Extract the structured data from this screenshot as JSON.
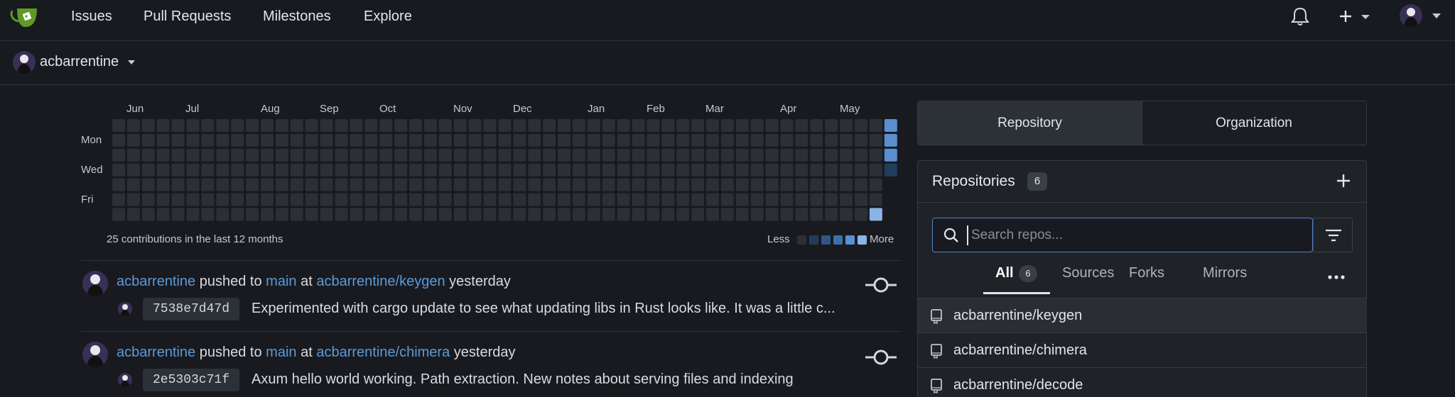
{
  "nav": {
    "links": [
      "Issues",
      "Pull Requests",
      "Milestones",
      "Explore"
    ]
  },
  "context": {
    "user": "acbarrentine"
  },
  "heatmap": {
    "months": [
      "Jun",
      "Jul",
      "Aug",
      "Sep",
      "Oct",
      "Nov",
      "Dec",
      "Jan",
      "Feb",
      "Mar",
      "Apr",
      "May"
    ],
    "days": [
      "Mon",
      "Wed",
      "Fri"
    ],
    "weeks": 53,
    "total": "25 contributions in the last 12 months",
    "legend_less": "Less",
    "legend_more": "More",
    "colors": [
      "#2b2f36",
      "#223c5e",
      "#2e5688",
      "#3d6fae",
      "#5a8fd0",
      "#8ab3e6"
    ],
    "active_cells": [
      [
        51,
        6,
        4
      ],
      [
        52,
        0,
        3
      ],
      [
        52,
        1,
        3
      ],
      [
        52,
        2,
        3
      ],
      [
        52,
        3,
        0
      ]
    ]
  },
  "feed": [
    {
      "user": "acbarrentine",
      "verb": "pushed to",
      "branch": "main",
      "at": "at",
      "repo": "acbarrentine/keygen",
      "when": "yesterday",
      "sha": "7538e7d47d",
      "message": "Experimented with cargo update to see what updating libs in Rust looks like. It was a little c..."
    },
    {
      "user": "acbarrentine",
      "verb": "pushed to",
      "branch": "main",
      "at": "at",
      "repo": "acbarrentine/chimera",
      "when": "yesterday",
      "sha": "2e5303c71f",
      "message": "Axum hello world working. Path extraction. New notes about serving files and indexing"
    }
  ],
  "side": {
    "tabs": [
      "Repository",
      "Organization"
    ],
    "title": "Repositories",
    "count": "6",
    "search_placeholder": "Search repos...",
    "filter_tabs": [
      "All",
      "Sources",
      "Forks",
      "Mirrors"
    ],
    "all_count": "6",
    "repos": [
      "acbarrentine/keygen",
      "acbarrentine/chimera",
      "acbarrentine/decode"
    ]
  },
  "icons": {
    "logo": "gitea-teacup-logo",
    "bell": "bell-icon",
    "plus": "plus-icon",
    "commit": "git-commit-icon",
    "repo": "repo-book-icon",
    "search": "search-icon",
    "filter": "filter-icon",
    "more": "kebab-icon"
  }
}
